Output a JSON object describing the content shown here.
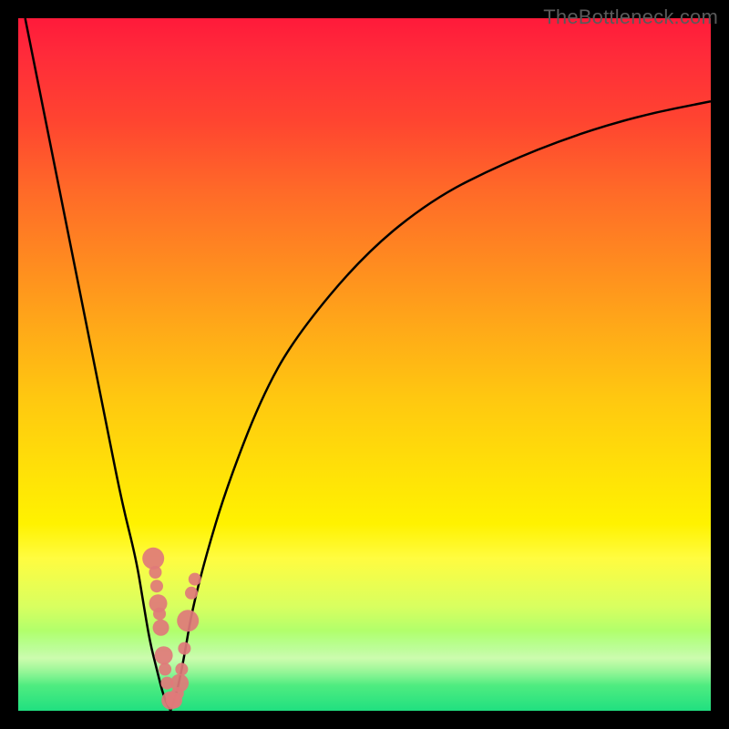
{
  "watermark": "TheBottleneck.com",
  "colors": {
    "frame": "#000000",
    "curve": "#000000",
    "marker": "#e07a7a",
    "gradient_top": "#ff1a3a",
    "gradient_bottom": "#20e080"
  },
  "chart_data": {
    "type": "line",
    "title": "",
    "xlabel": "",
    "ylabel": "",
    "xlim": [
      0,
      100
    ],
    "ylim": [
      0,
      100
    ],
    "notch_x": 22,
    "series": [
      {
        "name": "left_curve",
        "x": [
          1,
          3,
          5,
          7,
          9,
          11,
          13,
          15,
          17,
          18,
          19,
          20,
          21,
          22
        ],
        "values": [
          100,
          90,
          80,
          70,
          60,
          50,
          40,
          30,
          22,
          16,
          10,
          6,
          2,
          0
        ]
      },
      {
        "name": "right_curve",
        "x": [
          22,
          23,
          24,
          25,
          27,
          30,
          35,
          40,
          50,
          60,
          70,
          80,
          90,
          100
        ],
        "values": [
          0,
          3,
          8,
          14,
          22,
          32,
          45,
          54,
          66,
          74,
          79,
          83,
          86,
          88
        ]
      }
    ],
    "markers": [
      {
        "x": 19.5,
        "y": 22
      },
      {
        "x": 19.8,
        "y": 20
      },
      {
        "x": 20.0,
        "y": 18
      },
      {
        "x": 20.2,
        "y": 15.5
      },
      {
        "x": 20.4,
        "y": 14
      },
      {
        "x": 20.6,
        "y": 12
      },
      {
        "x": 21.0,
        "y": 8
      },
      {
        "x": 21.2,
        "y": 6
      },
      {
        "x": 21.5,
        "y": 4
      },
      {
        "x": 22.0,
        "y": 1.5
      },
      {
        "x": 22.5,
        "y": 1.5
      },
      {
        "x": 23.0,
        "y": 2.5
      },
      {
        "x": 23.3,
        "y": 4
      },
      {
        "x": 23.6,
        "y": 6
      },
      {
        "x": 24.0,
        "y": 9
      },
      {
        "x": 24.5,
        "y": 13
      },
      {
        "x": 25.0,
        "y": 17
      },
      {
        "x": 25.5,
        "y": 19
      }
    ]
  }
}
